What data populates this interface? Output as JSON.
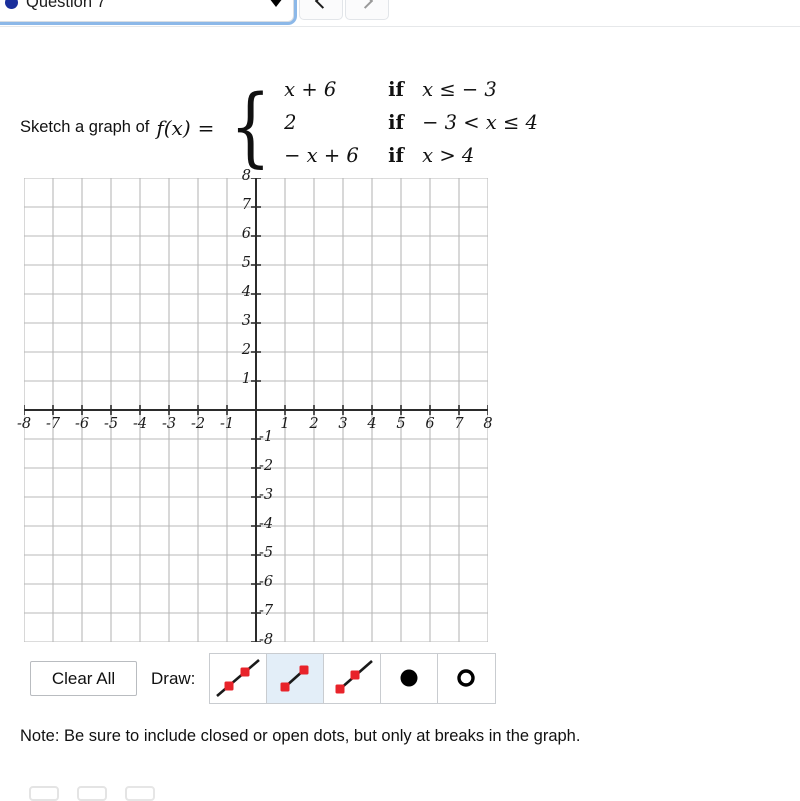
{
  "header": {
    "question_label": "Question 7",
    "dot_color": "#1a2f9c",
    "prev_icon": "chevron-left-icon",
    "next_icon": "chevron-right-icon",
    "caret_icon": "chevron-down-icon"
  },
  "problem": {
    "lead": "Sketch a graph of",
    "function_name": "f(x)",
    "equals": "=",
    "brace": "{",
    "cases": [
      {
        "expression": "x + 6",
        "if": "if",
        "condition": "x ≤ − 3"
      },
      {
        "expression": "2",
        "if": "if",
        "condition": "− 3 < x ≤ 4"
      },
      {
        "expression": "− x + 6",
        "if": "if",
        "condition": "x > 4"
      }
    ]
  },
  "graph": {
    "x_min": -8,
    "x_max": 8,
    "y_min": -8,
    "y_max": 8,
    "x_labels": [
      "-8",
      "-7",
      "-6",
      "-5",
      "-4",
      "-3",
      "-2",
      "-1",
      "1",
      "2",
      "3",
      "4",
      "5",
      "6",
      "7",
      "8"
    ],
    "y_labels": [
      "8",
      "7",
      "6",
      "5",
      "4",
      "3",
      "2",
      "1",
      "-1",
      "-2",
      "-3",
      "-4",
      "-5",
      "-6",
      "-7",
      "-8"
    ],
    "grid_color": "#b8b8b8",
    "axis_color": "#2b2b2b",
    "grid_on": true,
    "plotted_curves": []
  },
  "toolbar": {
    "clear_all_label": "Clear All",
    "draw_label": "Draw:",
    "selected_index": 1,
    "tools": [
      {
        "name": "line-tool",
        "icon": "line-through-two-points-icon",
        "selected": false
      },
      {
        "name": "segment-tool",
        "icon": "line-segment-icon",
        "selected": true
      },
      {
        "name": "ray-tool",
        "icon": "ray-icon",
        "selected": false
      },
      {
        "name": "closed-dot-tool",
        "icon": "filled-circle-icon",
        "selected": false
      },
      {
        "name": "open-dot-tool",
        "icon": "hollow-circle-icon",
        "selected": false
      }
    ],
    "point_color": "#e8232a",
    "stroke_color": "#1a1a1a",
    "selected_bg": "#e3eef8"
  },
  "note": {
    "text": "Note: Be sure to include closed or open dots, but only at breaks in the graph."
  }
}
